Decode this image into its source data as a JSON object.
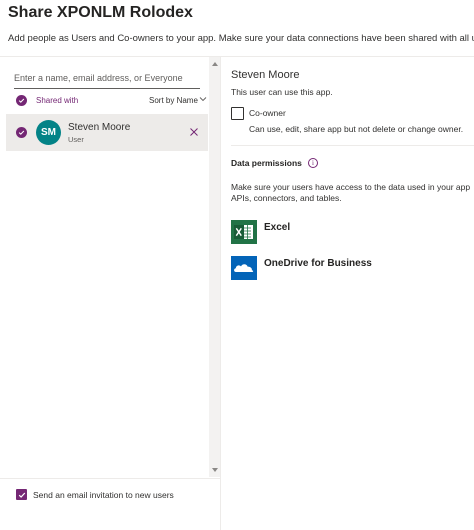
{
  "header": {
    "title": "Share XPONLM Rolodex",
    "subtitle": "Add people as Users and Co-owners to your app. Make sure your data connections have been shared with all users."
  },
  "left_panel": {
    "search_placeholder": "Enter a name, email address, or Everyone",
    "shared_with_label": "Shared with",
    "sort_label": "Sort by Name",
    "users": [
      {
        "initials": "SM",
        "name": "Steven Moore",
        "role": "User",
        "avatar_color": "#038387",
        "selected": true
      }
    ],
    "invite_label": "Send an email invitation to new users",
    "invite_checked": true
  },
  "detail": {
    "name": "Steven Moore",
    "status": "This user can use this app.",
    "coowner_label": "Co-owner",
    "coowner_checked": false,
    "coowner_desc": "Can use, edit, share app but not delete or change owner.",
    "permissions_title": "Data permissions",
    "permissions_desc_line1": "Make sure your users have access to the data used in your app",
    "permissions_desc_line2": "APIs, connectors, and tables.",
    "connectors": [
      {
        "name": "Excel",
        "icon": "excel-icon"
      },
      {
        "name": "OneDrive for Business",
        "icon": "onedrive-icon"
      }
    ]
  },
  "colors": {
    "accent": "#742774",
    "excel": "#217346",
    "onedrive": "#0364b8",
    "avatar": "#038387"
  }
}
